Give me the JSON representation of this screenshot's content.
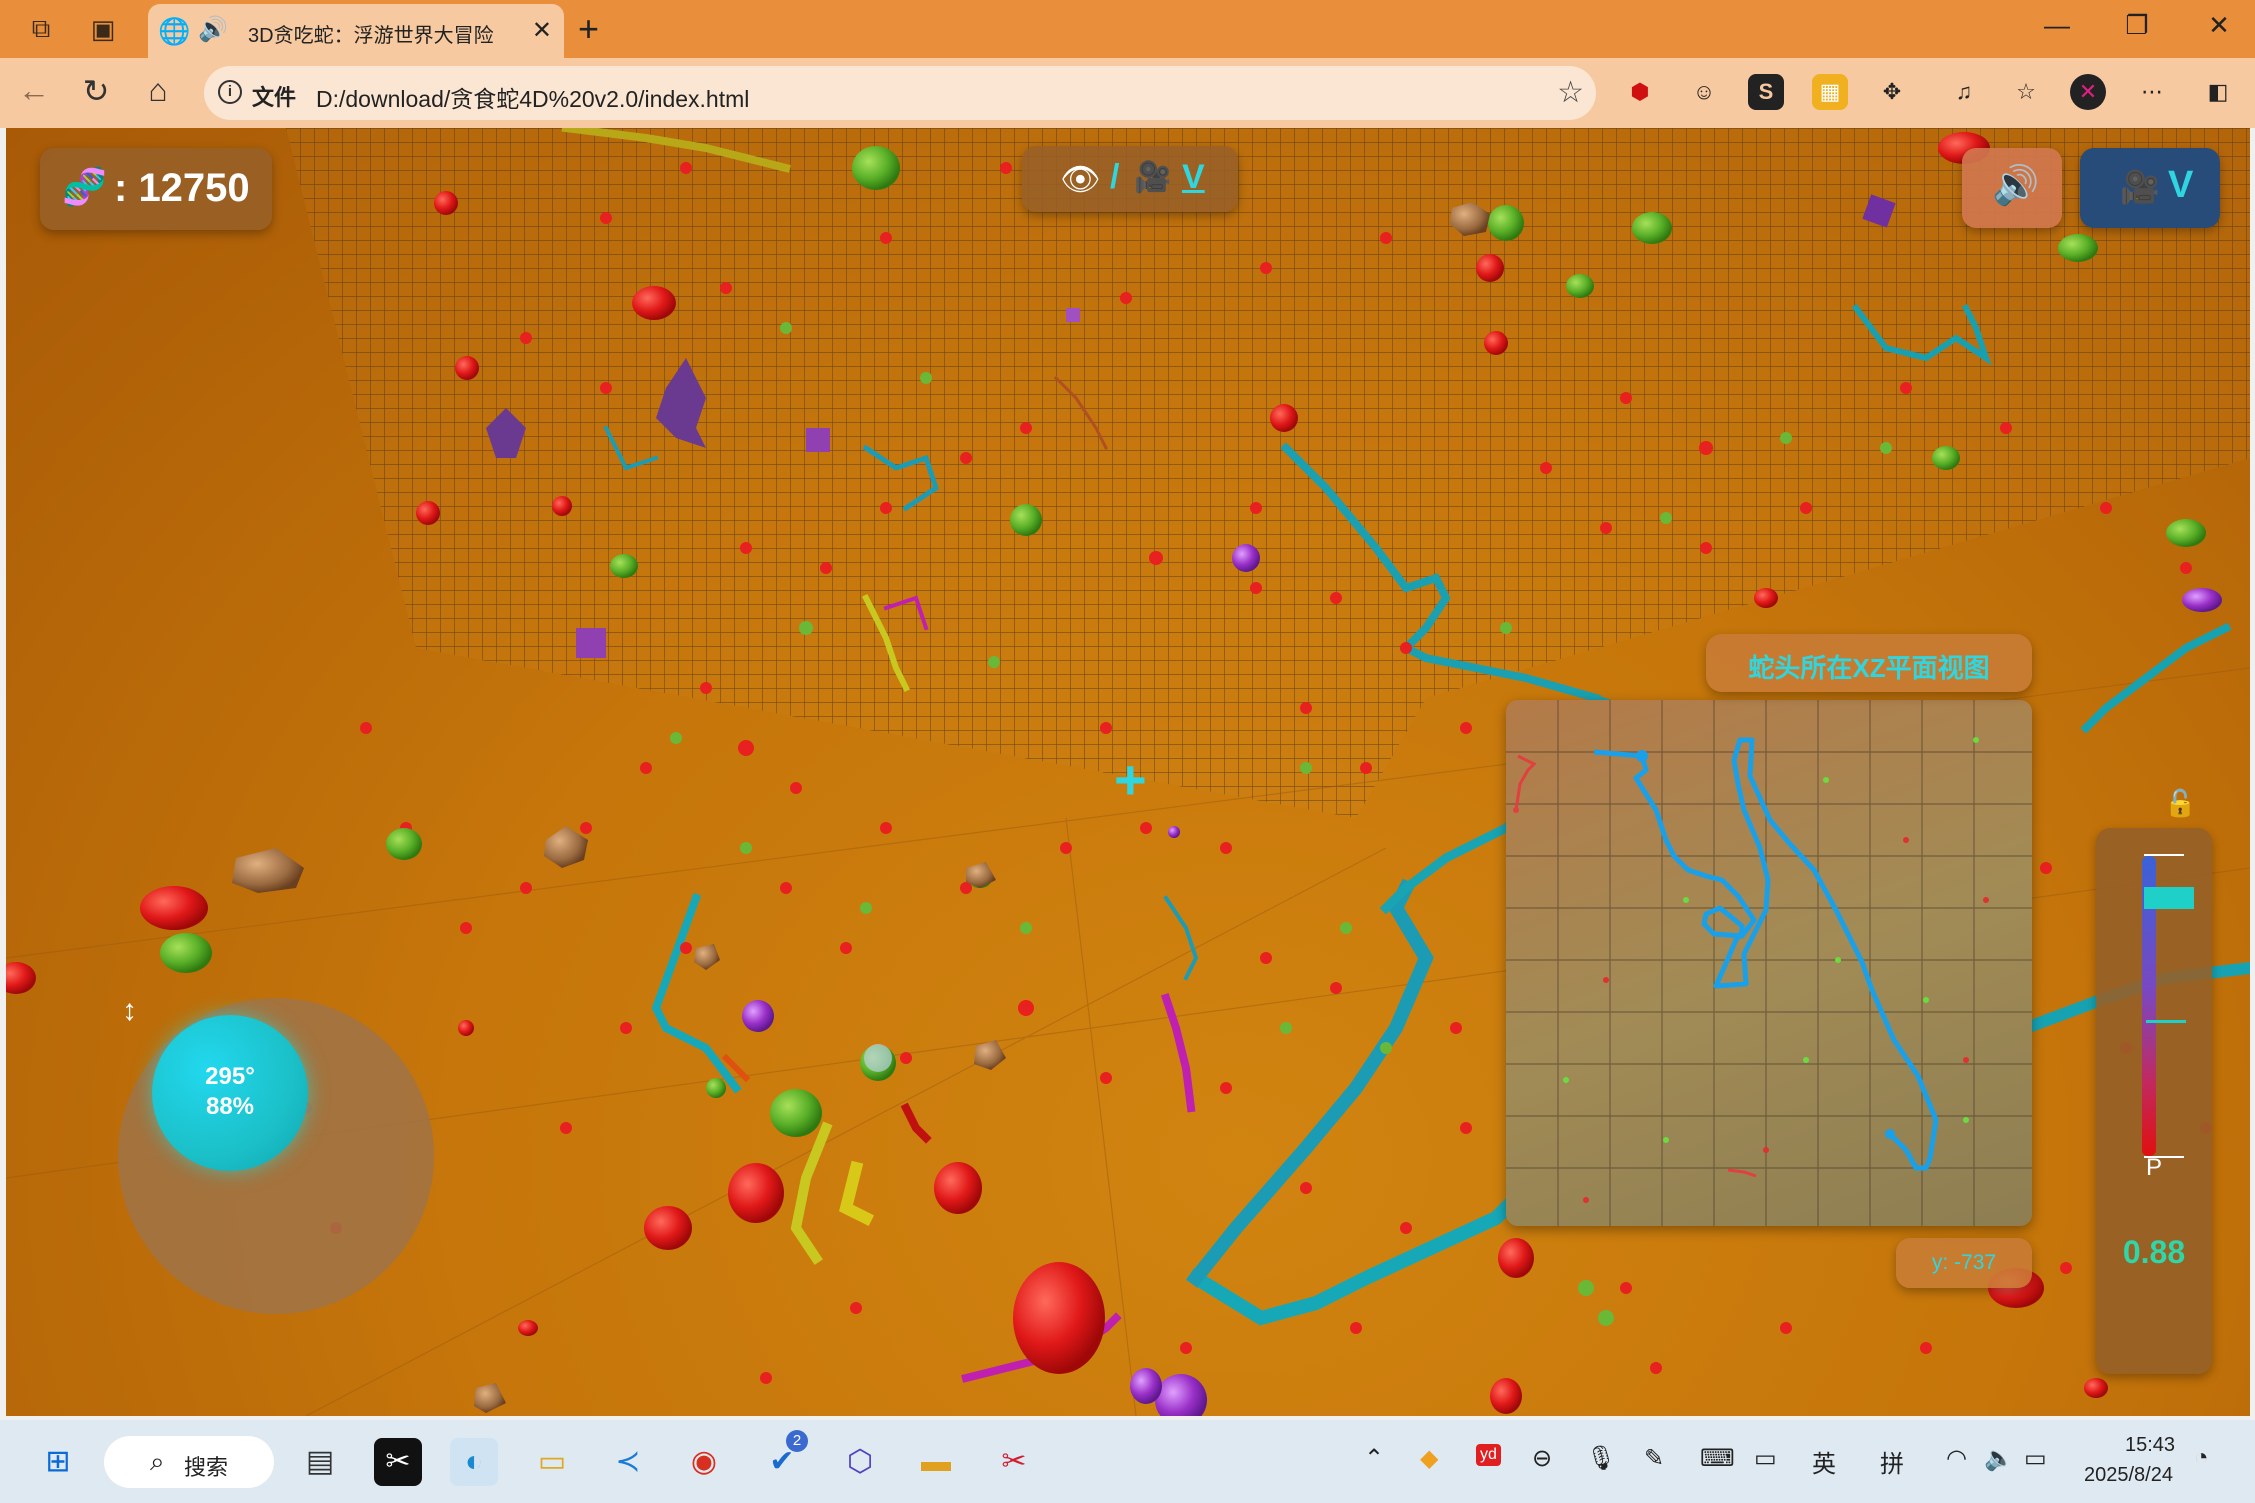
{
  "browser": {
    "tab_title": "3D贪吃蛇：浮游世界大冒险",
    "file_label": "文件",
    "url": "D:/download/贪食蛇4D%20v2.0/index.html"
  },
  "game": {
    "score": "12750",
    "view_toggle": {
      "eye": "👁",
      "slash": "/",
      "camera": "🎥",
      "key": "V"
    },
    "camera_button": {
      "camera": "🎥",
      "key": "V"
    },
    "crosshair": "+",
    "minimap_title": "蛇头所在XZ平面视图",
    "y_readout": "y: -737",
    "joystick": {
      "angle": "295°",
      "percent": "88%"
    },
    "speed": {
      "label": "P",
      "value": "0.88",
      "handle_level": 0.88
    },
    "colors": {
      "accent": "#2fd6e0",
      "snake_blue": "#1aa0e8",
      "food_red": "#e01818",
      "ground": "#c6760a"
    }
  },
  "taskbar": {
    "search": "搜索",
    "badge": "2",
    "ime_en": "英",
    "ime_pin": "拼",
    "time": "15:43",
    "date": "2025/8/24"
  }
}
